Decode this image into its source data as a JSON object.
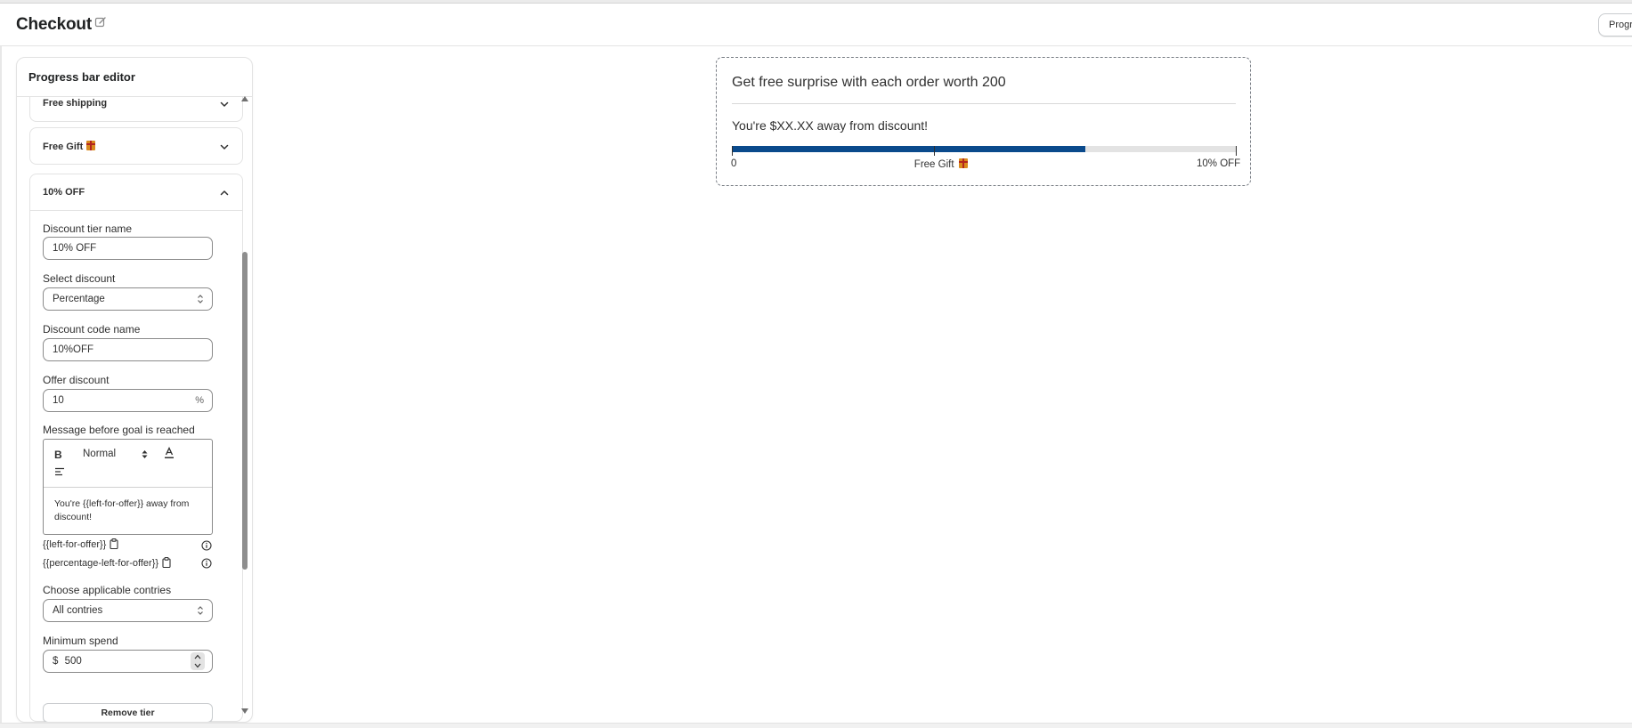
{
  "page": {
    "title": "Checkout",
    "header_button_label": "Progr"
  },
  "editor": {
    "title": "Progress bar editor",
    "tiers": [
      {
        "label": "Free shipping",
        "expanded": false
      },
      {
        "label": "Free Gift",
        "icon": "gift-emoji",
        "expanded": false
      },
      {
        "label": "10% OFF",
        "expanded": true
      }
    ],
    "form": {
      "tier_name_label": "Discount tier name",
      "tier_name_value": "10% OFF",
      "select_discount_label": "Select discount",
      "select_discount_value": "Percentage",
      "code_name_label": "Discount code name",
      "code_name_value": "10%OFF",
      "offer_discount_label": "Offer discount",
      "offer_discount_value": "10",
      "offer_discount_suffix": "%",
      "message_label": "Message before goal is reached",
      "rte_bold": "B",
      "rte_format": "Normal",
      "message_text": "You're {{left-for-offer}} away from discount!",
      "variables": [
        "{{left-for-offer}}",
        "{{percentage-left-for-offer}}"
      ],
      "countries_label": "Choose applicable contries",
      "countries_value": "All contries",
      "min_spend_label": "Minimum spend",
      "min_spend_prefix": "$",
      "min_spend_value": "500",
      "remove_button": "Remove tier"
    }
  },
  "preview": {
    "headline": "Get free surprise with each order worth 200",
    "message": "You're $XX.XX away from discount!",
    "progress_fraction": 0.7,
    "milestones": [
      {
        "label": "0",
        "at": 0
      },
      {
        "label": "Free Gift",
        "icon": "gift-emoji",
        "at": 0.4
      },
      {
        "label": "10% OFF",
        "at": 1
      }
    ],
    "fill_color": "#0a4a8c",
    "track_color": "#e3e3e3"
  }
}
